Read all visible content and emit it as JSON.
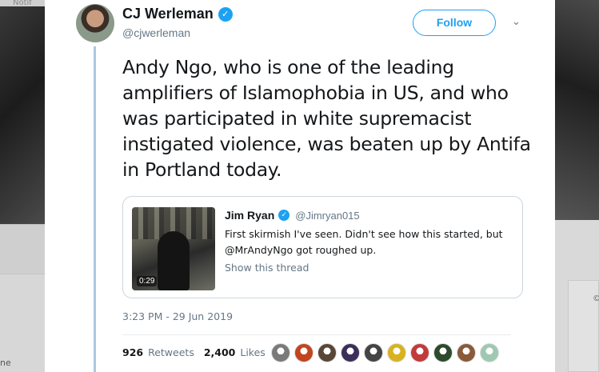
{
  "background": {
    "top_left_text": "Notif",
    "bottom_left_text": "ne",
    "right_text": "©"
  },
  "tweet": {
    "author_name": "CJ Werleman",
    "author_handle": "@cjwerleman",
    "verified": true,
    "follow_label": "Follow",
    "text": "Andy Ngo, who is one of the leading amplifiers of Islamophobia in US, and who was participated in white supremacist instigated violence, was beaten up by Antifa in Portland today.",
    "timestamp": "3:23 PM - 29 Jun 2019",
    "retweets_count": "926",
    "retweets_label": "Retweets",
    "likes_count": "2,400",
    "likes_label": "Likes",
    "accent_color": "#1da1f2",
    "liker_avatar_colors": [
      "#7a7a7a",
      "#c2451e",
      "#5a4636",
      "#3b2f5a",
      "#444444",
      "#d8b21f",
      "#c23a3a",
      "#2d4a2d",
      "#8a5a3a",
      "#9fc8b0"
    ]
  },
  "quoted_tweet": {
    "author_name": "Jim Ryan",
    "author_handle": "@Jimryan015",
    "verified": true,
    "text": "First skirmish I've seen. Didn't see how this started, but @MrAndyNgo got roughed up.",
    "show_thread_label": "Show this thread",
    "video_duration": "0:29"
  }
}
